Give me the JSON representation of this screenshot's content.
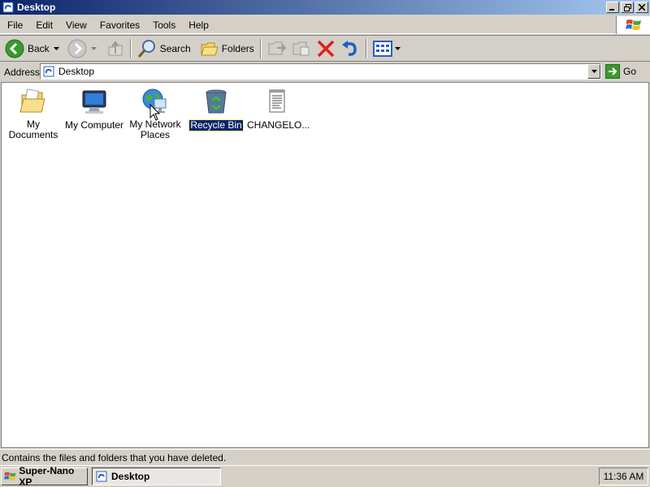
{
  "window": {
    "title": "Desktop",
    "menu": [
      "File",
      "Edit",
      "View",
      "Favorites",
      "Tools",
      "Help"
    ]
  },
  "toolbar": {
    "back_label": "Back",
    "search_label": "Search",
    "folders_label": "Folders"
  },
  "address": {
    "label": "Address",
    "value": "Desktop",
    "go_label": "Go"
  },
  "desktop_items": [
    {
      "label": "My Documents",
      "icon": "folder-documents-icon"
    },
    {
      "label": "My Computer",
      "icon": "computer-icon"
    },
    {
      "label": "My Network Places",
      "icon": "network-places-icon"
    },
    {
      "label": "Recycle Bin",
      "icon": "recycle-bin-icon",
      "selected": true
    },
    {
      "label": "CHANGELO...",
      "icon": "text-file-icon"
    }
  ],
  "status": {
    "text": "Contains the files and folders that you have deleted."
  },
  "taskbar": {
    "start_label": "Super-Nano XP",
    "task_label": "Desktop",
    "clock": "11:36 AM"
  },
  "colors": {
    "title_gradient_start": "#0a246a",
    "title_gradient_end": "#a6caf0",
    "face": "#d4d0c8",
    "selection": "#0a246a"
  }
}
